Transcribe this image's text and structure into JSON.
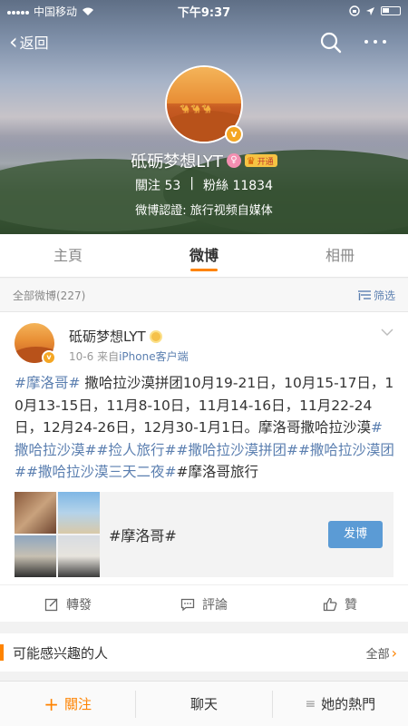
{
  "status_bar": {
    "carrier": "中国移动",
    "time": "下午9:37"
  },
  "topbar": {
    "back_label": "返回"
  },
  "profile": {
    "name": "砥砺梦想LYT",
    "vip_label": "开通",
    "following_label": "關注",
    "following_count": "53",
    "separator": "|",
    "followers_label": "粉絲",
    "followers_count": "11834",
    "verification": "微博認證: 旅行视频自媒体"
  },
  "tabs": [
    {
      "label": "主頁",
      "active": false
    },
    {
      "label": "微博",
      "active": true
    },
    {
      "label": "相冊",
      "active": false
    }
  ],
  "filter_bar": {
    "count_text": "全部微博(227)",
    "filter_label": "筛选"
  },
  "post": {
    "author": "砥砺梦想LYT",
    "date": "10-6",
    "source_prefix": "来自",
    "source": "iPhone客户端",
    "segments": [
      {
        "text": "#摩洛哥#",
        "hl": true
      },
      {
        "text": " 撒哈拉沙漠拼团10月19-21日，10月15-17日，10月13-15日，11月8-10日，11月14-16日，11月22-24日，12月24-26日，12月30-1月1日。摩洛哥撒哈拉沙漠",
        "hl": false
      },
      {
        "text": "#撒哈拉沙漠##捡人旅行##撒哈拉沙漠拼团##撒哈拉沙漠团##撒哈拉沙漠三天二夜#",
        "hl": true
      },
      {
        "text": "#摩洛哥旅行",
        "hl": false
      }
    ],
    "attachment_topic": "#摩洛哥#",
    "post_button": "发博",
    "actions": {
      "repost": "轉發",
      "comment": "評論",
      "like": "贊"
    }
  },
  "recommend": {
    "title": "可能感兴趣的人",
    "all_label": "全部"
  },
  "bottom_bar": {
    "follow": "關注",
    "chat": "聊天",
    "hot": "她的熱門"
  },
  "colors": {
    "accent": "#fe8300",
    "link": "#5b7fb0",
    "button": "#5b9bd5"
  }
}
